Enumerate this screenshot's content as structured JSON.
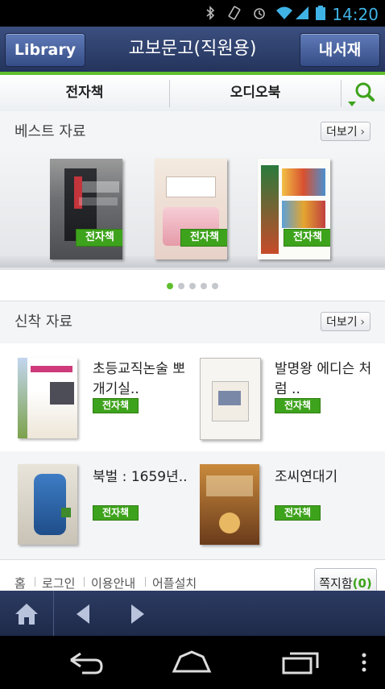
{
  "status_bar": {
    "time": "14:20",
    "icons": [
      "bluetooth-icon",
      "vibrate-icon",
      "alarm-icon",
      "wifi-icon",
      "signal-icon",
      "battery-icon"
    ]
  },
  "header": {
    "left_button": "Library",
    "title": "교보문고(직원용)",
    "right_button": "내서재"
  },
  "tabs": {
    "ebook": "전자책",
    "audiobook": "오디오북"
  },
  "best": {
    "label": "베스트 자료",
    "more": "더보기",
    "books": [
      {
        "badge": "전자책"
      },
      {
        "badge": "전자책"
      },
      {
        "badge": "전자책"
      }
    ]
  },
  "new": {
    "label": "신착 자료",
    "more": "더보기",
    "items": [
      {
        "title": "초등교직논술 뽀개기실..",
        "badge": "전자책"
      },
      {
        "title": "발명왕 에디슨 처럼 ..",
        "badge": "전자책"
      },
      {
        "title": "북벌 : 1659년..",
        "badge": "전자책"
      },
      {
        "title": "조씨연대기",
        "badge": "전자책"
      }
    ]
  },
  "footer": {
    "links": [
      "홈",
      "로그인",
      "이용안내",
      "어플설치"
    ],
    "notice_label": "쪽지함",
    "notice_count": "(0)"
  },
  "colors": {
    "accent_green": "#5fbf2e",
    "badge_green": "#3ea31c",
    "header_blue": "#2c3d67"
  }
}
